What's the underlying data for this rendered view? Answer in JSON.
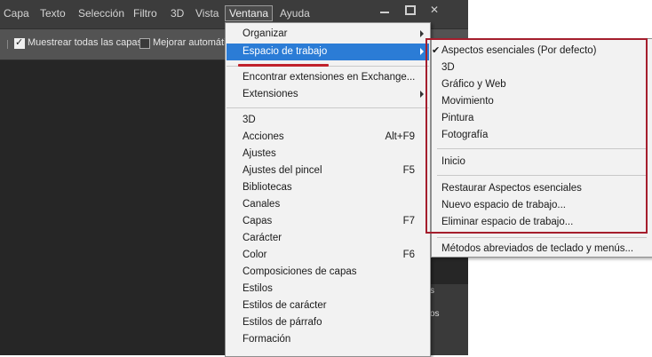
{
  "menubar": {
    "items": [
      "Capa",
      "Texto",
      "Selección",
      "Filtro",
      "3D",
      "Vista",
      "Ventana",
      "Ayuda"
    ],
    "active": "Ventana"
  },
  "options_bar": {
    "sample_all_layers": "Muestrear todas las capas",
    "sample_all_layers_checked": true,
    "enhance": "Mejorar automátic",
    "enhance_checked": false
  },
  "panel_fragments": [
    "s",
    "os"
  ],
  "ventana_menu": {
    "items": [
      {
        "label": "Organizar",
        "submenu": true
      },
      {
        "label": "Espacio de trabajo",
        "submenu": true,
        "highlighted": true
      },
      {
        "label": "Encontrar extensiones en Exchange..."
      },
      {
        "label": "Extensiones",
        "submenu": true
      },
      {
        "label": "3D"
      },
      {
        "label": "Acciones",
        "shortcut": "Alt+F9"
      },
      {
        "label": "Ajustes"
      },
      {
        "label": "Ajustes del pincel",
        "shortcut": "F5"
      },
      {
        "label": "Bibliotecas"
      },
      {
        "label": "Canales"
      },
      {
        "label": "Capas",
        "shortcut": "F7"
      },
      {
        "label": "Carácter"
      },
      {
        "label": "Color",
        "shortcut": "F6"
      },
      {
        "label": "Composiciones de capas"
      },
      {
        "label": "Estilos"
      },
      {
        "label": "Estilos de carácter"
      },
      {
        "label": "Estilos de párrafo"
      },
      {
        "label": "Formación"
      }
    ]
  },
  "workspace_submenu": {
    "items": [
      {
        "label": "Aspectos esenciales (Por defecto)",
        "checked": true
      },
      {
        "label": "3D"
      },
      {
        "label": "Gráfico y Web"
      },
      {
        "label": "Movimiento"
      },
      {
        "label": "Pintura"
      },
      {
        "label": "Fotografía"
      },
      {
        "label": "Inicio"
      },
      {
        "label": "Restaurar Aspectos esenciales"
      },
      {
        "label": "Nuevo espacio de trabajo..."
      },
      {
        "label": "Eliminar espacio de trabajo..."
      },
      {
        "label": "Métodos abreviados de teclado y menús..."
      }
    ]
  },
  "colors": {
    "highlight": "#2b7cd6",
    "annotation_red": "#a51e2d"
  }
}
